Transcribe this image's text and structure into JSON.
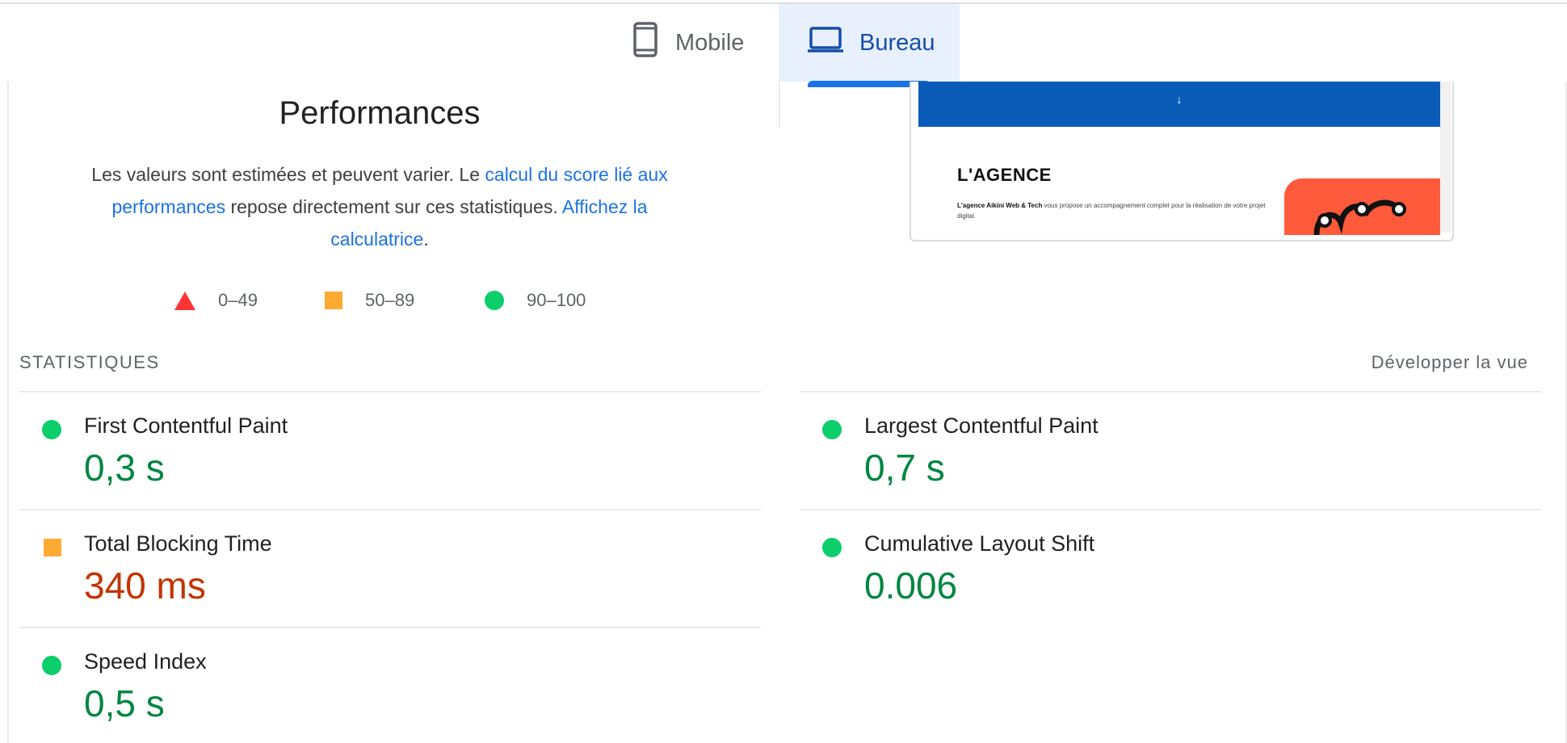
{
  "tabs": {
    "mobile_label": "Mobile",
    "desktop_label": "Bureau",
    "active": "desktop"
  },
  "performance": {
    "title": "Performances",
    "desc_text_1": "Les valeurs sont estimées et peuvent varier. Le ",
    "desc_link_1": "calcul du score lié aux performances",
    "desc_text_2": " repose directement sur ces statistiques. ",
    "desc_link_2": "Affichez la calculatrice",
    "desc_text_3": "."
  },
  "legend": {
    "poor": "0–49",
    "average": "50–89",
    "good": "90–100"
  },
  "preview": {
    "arrow": "↓",
    "heading": "L'AGENCE",
    "text_bold": "L'agence Aikini Web & Tech",
    "text_rest": " vous propose un accompagnement complet pour la réalisation de votre projet digital."
  },
  "statistics": {
    "label": "STATISTIQUES",
    "expand_label": "Développer la vue",
    "metrics": [
      {
        "name": "First Contentful Paint",
        "value": "0,3 s",
        "rating": "good"
      },
      {
        "name": "Largest Contentful Paint",
        "value": "0,7 s",
        "rating": "good"
      },
      {
        "name": "Total Blocking Time",
        "value": "340 ms",
        "rating": "average"
      },
      {
        "name": "Cumulative Layout Shift",
        "value": "0.006",
        "rating": "good"
      },
      {
        "name": "Speed Index",
        "value": "0,5 s",
        "rating": "good"
      }
    ]
  },
  "colors": {
    "good": "#0cce6b",
    "average": "#ffaa33",
    "poor": "#ff3333",
    "good_text": "#018642",
    "average_text": "#c33300",
    "accent": "#1a73e8"
  }
}
